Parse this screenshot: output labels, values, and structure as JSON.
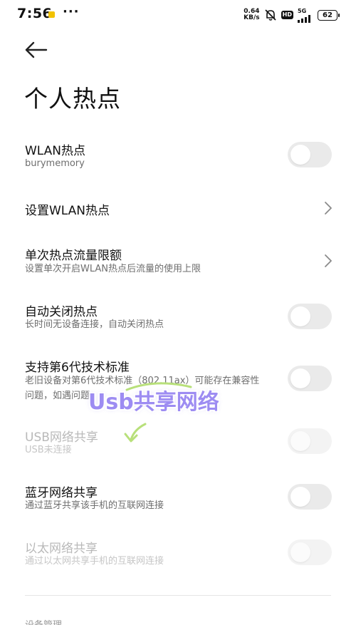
{
  "status_bar": {
    "time": "7:56",
    "more": "···",
    "net_speed_value": "0.64",
    "net_speed_unit": "KB/s",
    "hd": "HD",
    "network": "5G",
    "battery": "62"
  },
  "page_title": "个人热点",
  "rows": [
    {
      "title": "WLAN热点",
      "subtitle": "burymemory",
      "control": "toggle",
      "checked": false,
      "enabled": true
    },
    {
      "title": "设置WLAN热点",
      "control": "chevron",
      "enabled": true
    },
    {
      "title": "单次热点流量限额",
      "subtitle": "设置单次开启WLAN热点后流量的使用上限",
      "control": "chevron",
      "enabled": true
    },
    {
      "title": "自动关闭热点",
      "subtitle": "长时间无设备连接，自动关闭热点",
      "control": "toggle",
      "checked": false,
      "enabled": true
    },
    {
      "title": "支持第6代技术标准",
      "subtitle_line1": "老旧设备对第6代技术标准（802.11ax）可能存在兼容性",
      "subtitle_line2": "问题，如遇问题",
      "control": "toggle",
      "checked": false,
      "enabled": true
    },
    {
      "title": "USB网络共享",
      "subtitle": "USB未连接",
      "control": "toggle",
      "checked": false,
      "enabled": false
    },
    {
      "title": "蓝牙网络共享",
      "subtitle": "通过蓝牙共享该手机的互联网连接",
      "control": "toggle",
      "checked": false,
      "enabled": true
    },
    {
      "title": "以太网络共享",
      "subtitle": "通过以太网共享手机的互联网连接",
      "control": "toggle",
      "checked": false,
      "enabled": false
    }
  ],
  "section_header": "设备管理",
  "watermark": {
    "text": "Usb共享网络",
    "color": "#9d8cf2"
  },
  "colors": {
    "toggle_off": "#eaeaea",
    "disabled_text": "#b9b9b9",
    "subtitle": "#6e6e6e"
  }
}
